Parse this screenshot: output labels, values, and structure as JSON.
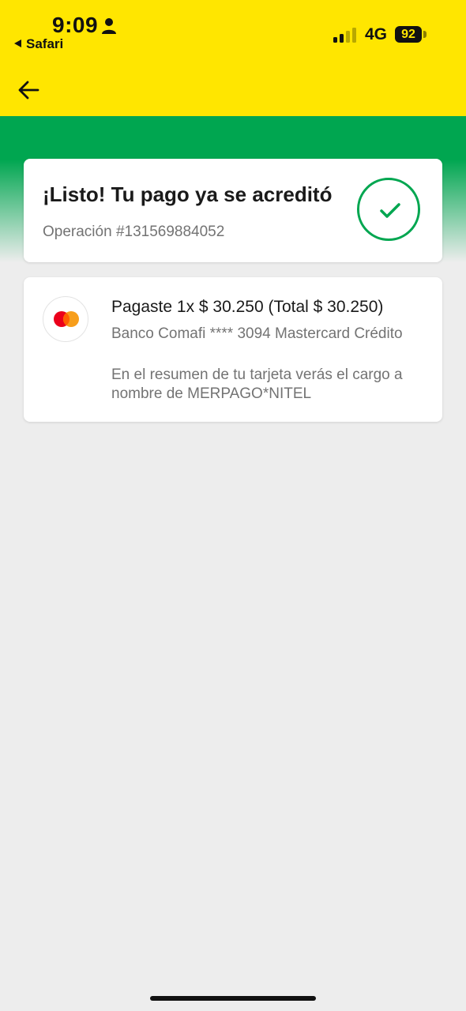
{
  "status_bar": {
    "time": "9:09",
    "back_app": "Safari",
    "network": "4G",
    "battery": "92"
  },
  "status": {
    "title": "¡Listo! Tu pago ya se acreditó",
    "operation": "Operación #131569884052"
  },
  "payment": {
    "amount_line": "Pagaste 1x $ 30.250 (Total $ 30.250)",
    "card_line": "Banco Comafi **** 3094 Mastercard Crédito",
    "summary_line": "En el resumen de tu tarjeta verás el cargo a nombre de MERPAGO*NITEL"
  },
  "icons": {
    "back": "arrow-left-icon",
    "success": "check-circle-icon",
    "card_brand": "mastercard-icon"
  },
  "colors": {
    "header": "#ffe600",
    "accent_green": "#00a650",
    "background": "#ededed"
  }
}
